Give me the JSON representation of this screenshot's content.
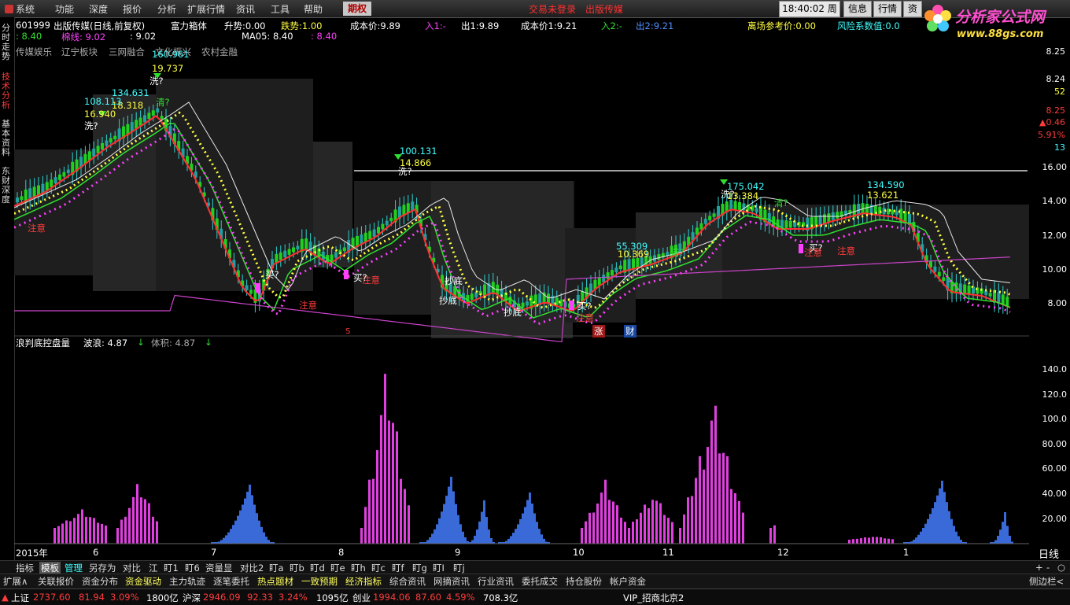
{
  "menubar": {
    "items": [
      "系统",
      "功能",
      "深度",
      "报价",
      "分析",
      "扩展行情",
      "资讯",
      "工具",
      "帮助"
    ],
    "active": "期权",
    "login": "交易未登录",
    "stock_short": "出版传媒",
    "time": "18:40:02",
    "weekday": "周六",
    "buttons": [
      "信息",
      "行情",
      "资"
    ]
  },
  "logo": {
    "text": "分析家公式网",
    "url": "www.88gs.com"
  },
  "sidetabs": [
    "分时走势",
    "技术分析",
    "基本资料",
    "东财深度"
  ],
  "info1": {
    "code": "601999",
    "name": "出版传媒(日线,前复权)",
    "indicator": "富力箱体",
    "rise": "升势:0.00",
    "trend": "跌势:1.00",
    "cost": "成本价:9.89",
    "in1": "入1:-",
    "out1": "出1:9.89",
    "cost1": "成本价1:9.21",
    "in2": "入2:-",
    "out2": "出2:9.21",
    "exit_ref": "离场参考价:0.00",
    "risk": "风险系数值:0.0"
  },
  "info2": {
    "a": ": 8.40",
    "line": "棉线: 9.02",
    "b": ": 9.02",
    "ma05": "MA05: 8.40",
    "c": ": 8.40"
  },
  "sectors": [
    "传媒娱乐",
    "辽宁板块",
    "三网融合",
    "文化振兴",
    "农村金融"
  ],
  "price_axis": [
    "16.00",
    "14.00",
    "12.00",
    "10.00",
    "8.00"
  ],
  "right_panel": {
    "p1": "8.25",
    "p2": "8.24",
    "vol": "52",
    "p3": "8.25",
    "chg": "▲0.46",
    "pct": "5.91%",
    "n": "13"
  },
  "vol_info": {
    "title": "浪判底控盘量",
    "wave": "波浪: 4.87",
    "vol": "体积: 4.87"
  },
  "vol_axis": [
    "140.0",
    "120.0",
    "100.0",
    "80.00",
    "60.00",
    "40.00",
    "20.00"
  ],
  "months": [
    "2015年",
    "6",
    "7",
    "8",
    "9",
    "10",
    "11",
    "12",
    "1"
  ],
  "period": "日线",
  "chart_labels": {
    "peaks": [
      [
        "160.961",
        "19.737"
      ],
      [
        "134.631",
        "18.318"
      ],
      [
        "108.113",
        "16.940"
      ],
      [
        "100.131",
        "14.866"
      ],
      [
        "175.042",
        "13.384"
      ],
      [
        "134.590",
        "13.621"
      ],
      [
        "55.309",
        "10.369"
      ]
    ],
    "wash": "洗?",
    "clear": "清?",
    "buy": "买?",
    "note": "注意",
    "bottom": "抄底",
    "event_s": "S",
    "event_rise": "涨",
    "event_fin": "财"
  },
  "tabs1": [
    "指标",
    "模板",
    "管理",
    "另存为",
    "对比",
    "江",
    "盯1",
    "盯6",
    "资量显",
    "对比2",
    "盯a",
    "盯b",
    "盯d",
    "盯e",
    "盯h",
    "盯c",
    "盯f",
    "盯g",
    "盯I",
    "盯j"
  ],
  "tabs1_right": [
    "+",
    "-",
    "○"
  ],
  "tabs2": [
    "扩展∧",
    "关联报价",
    "资金分布",
    "资金驱动",
    "主力轨迹",
    "逐笔委托",
    "热点题材",
    "一致预期",
    "经济指标",
    "综合资讯",
    "网摘资讯",
    "行业资讯",
    "委托成交",
    "持仓股份",
    "帐户资金"
  ],
  "tabs2_right": "侧边栏<",
  "status": {
    "sh": {
      "name": "上证",
      "price": "2737.60",
      "chg": "81.94",
      "pct": "3.09%",
      "amt": "1800亿"
    },
    "hs": {
      "name": "沪深",
      "price": "2946.09",
      "chg": "92.33",
      "pct": "3.24%",
      "amt": "1095亿"
    },
    "cy": {
      "name": "创业",
      "price": "1994.06",
      "chg": "87.60",
      "pct": "4.59%",
      "amt": "708.3亿"
    },
    "broker": "VIP_招商北京2"
  }
}
